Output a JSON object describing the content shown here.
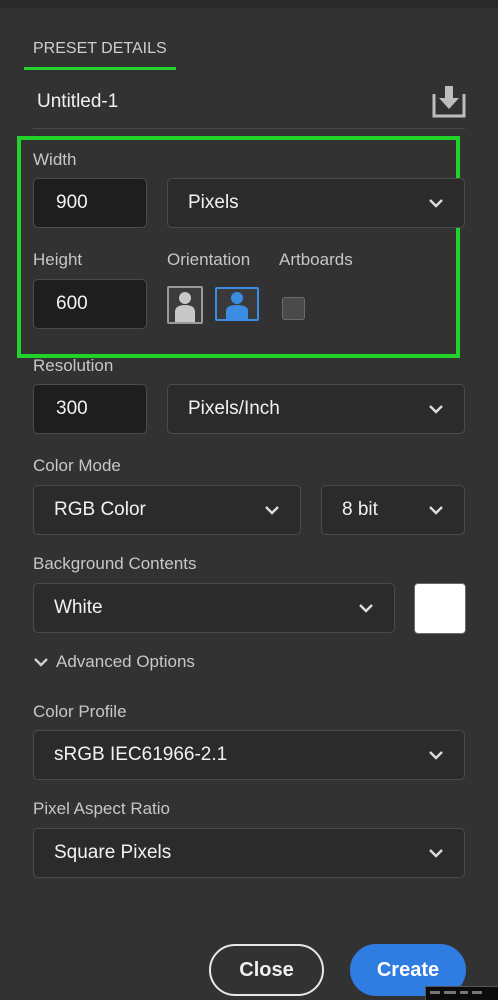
{
  "preset": {
    "section_title": "PRESET DETAILS",
    "name": "Untitled-1",
    "save_icon": "save-preset-icon"
  },
  "width": {
    "label": "Width",
    "value": "900",
    "unit": "Pixels"
  },
  "height": {
    "label": "Height",
    "value": "600"
  },
  "orientation": {
    "label": "Orientation",
    "selected": "landscape"
  },
  "artboards": {
    "label": "Artboards",
    "checked": false
  },
  "resolution": {
    "label": "Resolution",
    "value": "300",
    "unit": "Pixels/Inch"
  },
  "color_mode": {
    "label": "Color Mode",
    "mode": "RGB Color",
    "depth": "8 bit"
  },
  "background": {
    "label": "Background Contents",
    "value": "White",
    "swatch_color": "#ffffff"
  },
  "advanced": {
    "label": "Advanced Options"
  },
  "color_profile": {
    "label": "Color Profile",
    "value": "sRGB IEC61966-2.1"
  },
  "pixel_aspect": {
    "label": "Pixel Aspect Ratio",
    "value": "Square Pixels"
  },
  "buttons": {
    "close": "Close",
    "create": "Create"
  },
  "colors": {
    "highlight": "#22d22a",
    "accent": "#2f7de1",
    "panel": "#323232"
  }
}
